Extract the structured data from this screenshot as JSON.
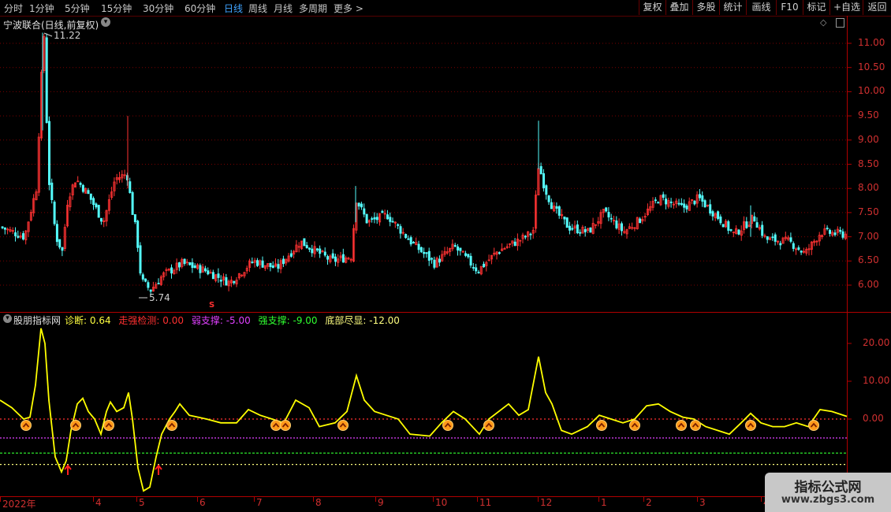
{
  "period_tabs": [
    {
      "label": "分时",
      "active": false
    },
    {
      "label": "1分钟",
      "active": false
    },
    {
      "label": "5分钟",
      "active": false
    },
    {
      "label": "15分钟",
      "active": false
    },
    {
      "label": "30分钟",
      "active": false
    },
    {
      "label": "60分钟",
      "active": false
    },
    {
      "label": "日线",
      "active": true
    },
    {
      "label": "周线",
      "active": false
    },
    {
      "label": "月线",
      "active": false
    },
    {
      "label": "多周期",
      "active": false
    },
    {
      "label": "更多 >",
      "active": false
    }
  ],
  "right_buttons": [
    "复权",
    "叠加",
    "多股",
    "统计",
    "画线",
    "F10",
    "标记",
    "+自选",
    "返回"
  ],
  "main_panel": {
    "title": "宁波联合(日线,前复权)",
    "high_label": "11.22",
    "low_label": "5.74",
    "price_ticks": [
      "11.00",
      "10.50",
      "10.00",
      "9.50",
      "9.00",
      "8.50",
      "8.00",
      "7.50",
      "7.00",
      "6.50",
      "6.00"
    ],
    "marker_s": "S"
  },
  "indicator": {
    "name": "股朋指标网",
    "items": [
      {
        "label": "诊断:",
        "value": "0.64",
        "color": "#ffff40"
      },
      {
        "label": "走强检测:",
        "value": "0.00",
        "color": "#ff3030"
      },
      {
        "label": "弱支撑:",
        "value": "-5.00",
        "color": "#e040ff"
      },
      {
        "label": "强支撑:",
        "value": "-9.00",
        "color": "#30ff30"
      },
      {
        "label": "底部尽显:",
        "value": "-12.00",
        "color": "#ffff80"
      }
    ],
    "ticks": [
      "20.00",
      "10.00",
      "0.00"
    ]
  },
  "x_axis": [
    "2022年",
    "4",
    "5",
    "6",
    "7",
    "8",
    "9",
    "10",
    "11",
    "12",
    "1",
    "2",
    "3",
    "4"
  ],
  "watermark": {
    "title": "指标公式网",
    "url": "www.zbgs3.com"
  },
  "colors": {
    "up": "#ff3232",
    "down": "#54fcfc",
    "line": "#ffff00",
    "grid": "#8b0000",
    "border": "#b00000"
  }
}
